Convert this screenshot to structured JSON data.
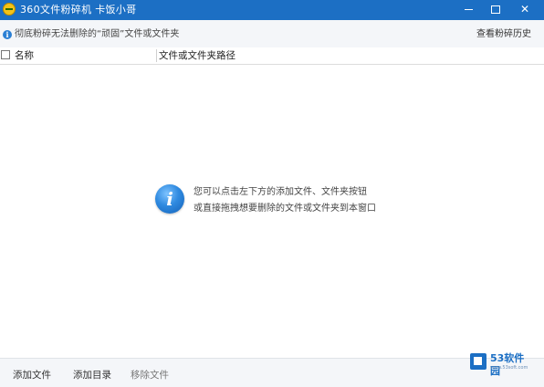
{
  "window": {
    "title": "360文件粉碎机  卡饭小哥",
    "min_label": "",
    "max_label": "",
    "close_label": "✕"
  },
  "infobar": {
    "icon_glyph": "i",
    "message": "彻底粉碎无法删除的“顽固”文件或文件夹",
    "history_link": "查看粉碎历史"
  },
  "columns": {
    "name": "名称",
    "path": "文件或文件夹路径"
  },
  "list": {
    "items": [],
    "hint_icon_glyph": "i",
    "hint_line1": "您可以点击左下方的添加文件、文件夹按钮",
    "hint_line2": "或直接拖拽想要删除的文件或文件夹到本窗口"
  },
  "footer": {
    "add_file": "添加文件",
    "add_dir": "添加目录",
    "remove_file": "移除文件"
  },
  "watermark": {
    "brand": "53软件园",
    "url": "www.53soft.com"
  },
  "colors": {
    "titlebar": "#1c6fc4",
    "info_icon": "#2a7fd4",
    "panel_bg": "#f4f6f9"
  },
  "icons": {
    "app": "shredder-app-icon",
    "info": "info-icon",
    "hint": "info-circle-icon"
  }
}
